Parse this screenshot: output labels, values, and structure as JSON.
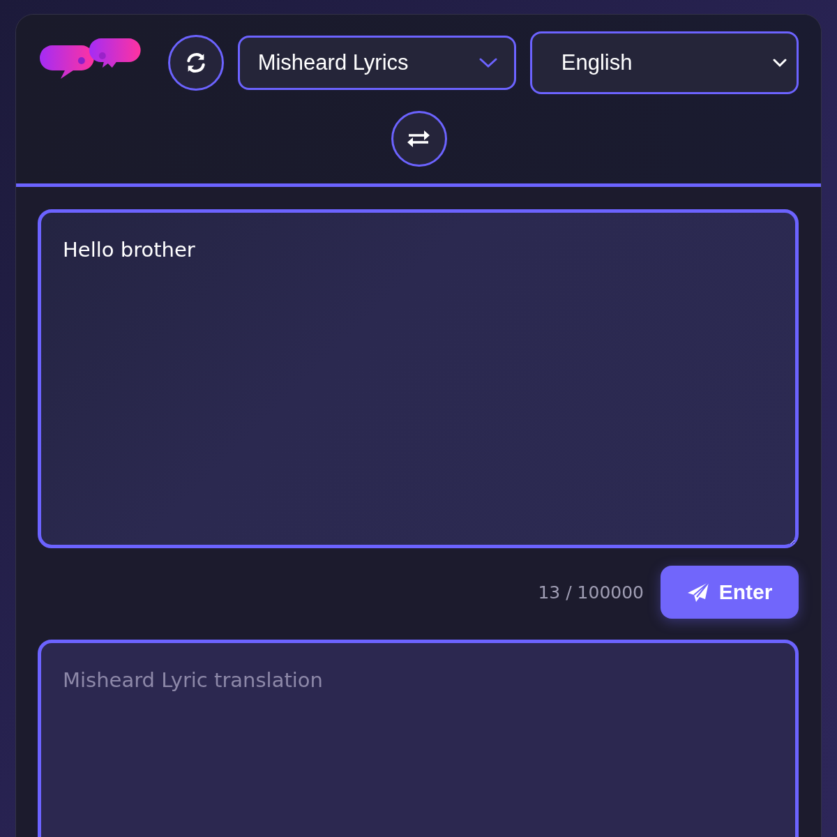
{
  "mode_select": {
    "value": "Misheard Lyrics"
  },
  "language_select": {
    "value": "English"
  },
  "input": {
    "value": "Hello brother"
  },
  "counter": "13 / 100000",
  "enter_button": {
    "label": "Enter"
  },
  "output": {
    "placeholder": "Misheard Lyric translation"
  }
}
